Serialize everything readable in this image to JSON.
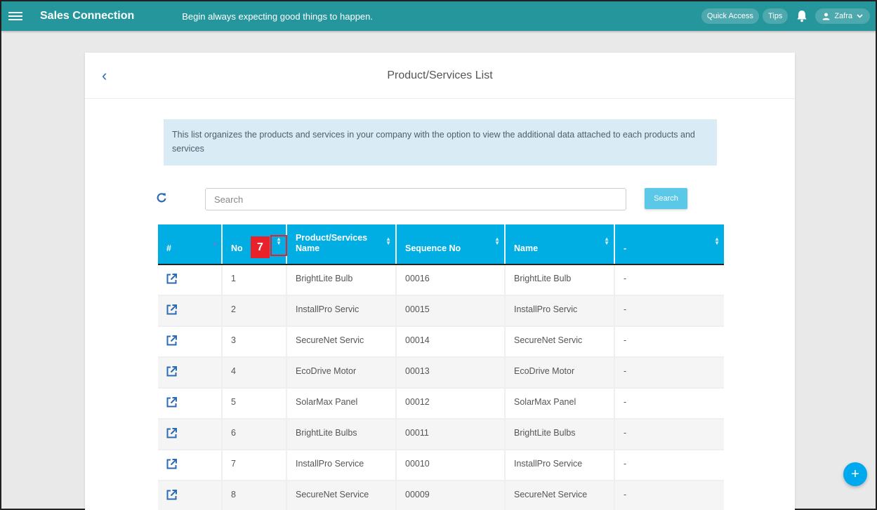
{
  "topbar": {
    "app_title": "Sales Connection",
    "motto": "Begin always expecting good things to happen.",
    "quick_access_label": "Quick Access",
    "tips_label": "Tips",
    "user_name": "Zafra"
  },
  "page": {
    "title": "Product/Services List",
    "info_text": "This list organizes the products and services in your company with the option to view the additional data attached to each products and services",
    "search_placeholder": "Search",
    "search_value": "",
    "search_button_label": "Search"
  },
  "annotation": {
    "badge_label": "7"
  },
  "table": {
    "headers": [
      "#",
      "No",
      "Product/Services Name",
      "Sequence No",
      "Name",
      "-"
    ],
    "rows": [
      {
        "no": "1",
        "product_name": "BrightLite Bulb",
        "sequence_no": "00016",
        "name": "BrightLite Bulb",
        "extra": "-"
      },
      {
        "no": "2",
        "product_name": "InstallPro Servic",
        "sequence_no": "00015",
        "name": "InstallPro Servic",
        "extra": "-"
      },
      {
        "no": "3",
        "product_name": "SecureNet Servic",
        "sequence_no": "00014",
        "name": "SecureNet Servic",
        "extra": "-"
      },
      {
        "no": "4",
        "product_name": "EcoDrive Motor",
        "sequence_no": "00013",
        "name": "EcoDrive Motor",
        "extra": "-"
      },
      {
        "no": "5",
        "product_name": "SolarMax Panel",
        "sequence_no": "00012",
        "name": "SolarMax Panel",
        "extra": "-"
      },
      {
        "no": "6",
        "product_name": "BrightLite Bulbs",
        "sequence_no": "00011",
        "name": "BrightLite Bulbs",
        "extra": "-"
      },
      {
        "no": "7",
        "product_name": "InstallPro Service",
        "sequence_no": "00010",
        "name": "InstallPro Service",
        "extra": "-"
      },
      {
        "no": "8",
        "product_name": "SecureNet Service",
        "sequence_no": "00009",
        "name": "SecureNet Service",
        "extra": "-"
      }
    ]
  },
  "fab": {
    "icon": "plus-icon"
  },
  "colors": {
    "topbar": "#26969d",
    "table_header": "#00aee3",
    "accent_blue": "#2b6bb5",
    "fab": "#00a8ee",
    "annotation_red": "#e8212a"
  }
}
